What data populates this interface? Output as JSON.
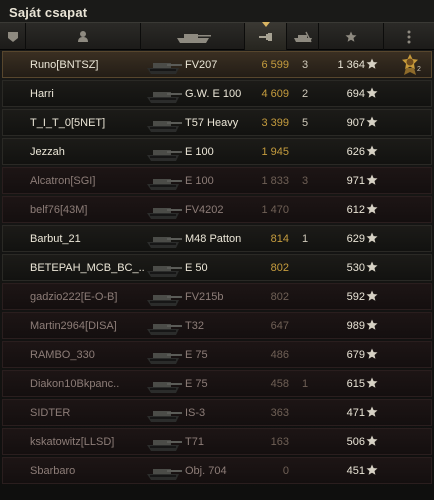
{
  "title": "Saját csapat",
  "columns": [
    {
      "key": "platoon",
      "icon": "platoon-icon"
    },
    {
      "key": "player",
      "icon": "player-icon"
    },
    {
      "key": "vehicle",
      "icon": "tank-icon"
    },
    {
      "key": "damage",
      "icon": "damage-icon",
      "sorted": true
    },
    {
      "key": "kills",
      "icon": "kills-icon"
    },
    {
      "key": "experience",
      "icon": "star-icon"
    },
    {
      "key": "medals",
      "icon": "medal-icon"
    }
  ],
  "colors": {
    "damage": "#c59c3e",
    "alive_text": "#ece7d8",
    "dead_text": "#8d7d78",
    "self_row": "#3a2f22"
  },
  "rows": [
    {
      "player": "Runo[BNTSZ]",
      "tank": "FV207",
      "damage": "6 599",
      "kills": "3",
      "exp": "1 364",
      "status": "self",
      "medal": "2"
    },
    {
      "player": "Harri",
      "tank": "G.W. E 100",
      "damage": "4 609",
      "kills": "2",
      "exp": "694",
      "status": "alive"
    },
    {
      "player": "T_I_T_0[5NET]",
      "tank": "T57 Heavy",
      "damage": "3 399",
      "kills": "5",
      "exp": "907",
      "status": "alive"
    },
    {
      "player": "Jezzah",
      "tank": "E 100",
      "damage": "1 945",
      "kills": "",
      "exp": "626",
      "status": "alive"
    },
    {
      "player": "Alcatron[SGI]",
      "tank": "E 100",
      "damage": "1 833",
      "kills": "3",
      "exp": "971",
      "status": "dead"
    },
    {
      "player": "belf76[43M]",
      "tank": "FV4202",
      "damage": "1 470",
      "kills": "",
      "exp": "612",
      "status": "dead"
    },
    {
      "player": "Barbut_21",
      "tank": "M48 Patton",
      "damage": "814",
      "kills": "1",
      "exp": "629",
      "status": "alive"
    },
    {
      "player": "BETEPAH_MCB_BC_...",
      "tank": "E 50",
      "damage": "802",
      "kills": "",
      "exp": "530",
      "status": "alive"
    },
    {
      "player": "gadzio222[E-O-B]",
      "tank": "FV215b",
      "damage": "802",
      "kills": "",
      "exp": "592",
      "status": "dead"
    },
    {
      "player": "Martin2964[DISA]",
      "tank": "T32",
      "damage": "647",
      "kills": "",
      "exp": "989",
      "status": "dead"
    },
    {
      "player": "RAMBO_330",
      "tank": "E 75",
      "damage": "486",
      "kills": "",
      "exp": "679",
      "status": "dead"
    },
    {
      "player": "Diakon10Bkpanc..",
      "tank": "E 75",
      "damage": "458",
      "kills": "1",
      "exp": "615",
      "status": "dead"
    },
    {
      "player": "SIDTER",
      "tank": "IS-3",
      "damage": "363",
      "kills": "",
      "exp": "471",
      "status": "dead"
    },
    {
      "player": "kskatowitz[LLSD]",
      "tank": "T71",
      "damage": "163",
      "kills": "",
      "exp": "506",
      "status": "dead"
    },
    {
      "player": "Sbarbaro",
      "tank": "Obj. 704",
      "damage": "0",
      "kills": "",
      "exp": "451",
      "status": "dead"
    }
  ]
}
